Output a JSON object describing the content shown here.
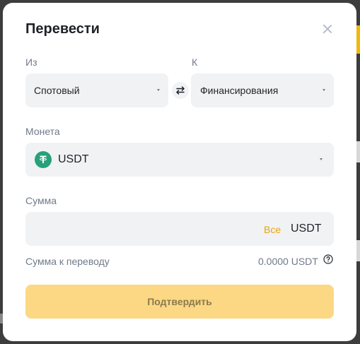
{
  "modal": {
    "title": "Перевести",
    "from_label": "Из",
    "to_label": "К",
    "from_account": "Спотовый",
    "to_account": "Финансирования",
    "coin_label": "Монета",
    "coin": "USDT",
    "amount_label": "Сумма",
    "amount_placeholder": "",
    "max_label": "Все",
    "amount_unit": "USDT",
    "transfer_amount_label": "Сумма к переводу",
    "transfer_amount_value": "0.0000 USDT",
    "confirm_label": "Подтвердить"
  },
  "colors": {
    "accent": "#f0b90b",
    "confirm_disabled": "#fcd884",
    "tether_green": "#26a17b"
  },
  "icons": {
    "close": "close-icon",
    "swap": "swap-icon",
    "coin": "tether-icon",
    "help": "question-circle-icon"
  }
}
